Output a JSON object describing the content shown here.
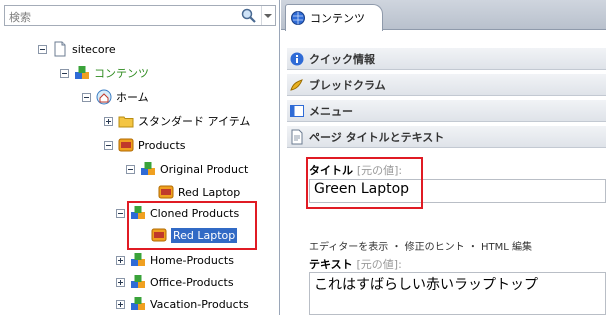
{
  "search": {
    "placeholder": "検索"
  },
  "tree": {
    "sitecore": "sitecore",
    "content": "コンテンツ",
    "home": "ホーム",
    "standard_items": "スタンダード アイテム",
    "products": "Products",
    "original_product": "Original Product",
    "red_laptop_1": "Red Laptop",
    "cloned_products": "Cloned Products",
    "red_laptop_2": "Red Laptop",
    "home_products": "Home-Products",
    "office_products": "Office-Products",
    "vacation_products": "Vacation-Products"
  },
  "editor": {
    "tab_label": "コンテンツ",
    "sections": {
      "quick_info": "クイック情報",
      "breadcrumb": "ブレッドクラム",
      "menu": "メニュー",
      "page_title_text": "ページ タイトルとテキスト"
    },
    "title_field": {
      "label": "タイトル",
      "original": "[元の値]:",
      "value": "Green Laptop"
    },
    "editor_links": "エディターを表示 ・ 修正のヒント ・ HTML 編集",
    "text_field": {
      "label": "テキスト",
      "original": "[元の値]:",
      "value": "これはすばらしい赤いラップトップ"
    }
  },
  "colors": {
    "highlight_red": "#e01b24",
    "selected_blue": "#316ac5",
    "content_green": "#2e8b1f"
  }
}
